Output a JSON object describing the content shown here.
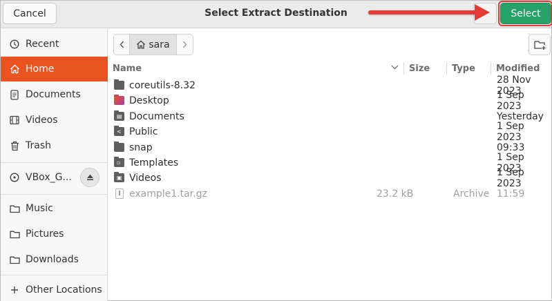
{
  "header": {
    "title": "Select Extract Destination",
    "cancel_label": "Cancel",
    "select_label": "Select"
  },
  "sidebar": {
    "items": [
      {
        "label": "Recent",
        "icon": "clock-icon"
      },
      {
        "label": "Home",
        "icon": "home-icon",
        "active": true
      },
      {
        "label": "Documents",
        "icon": "document-icon"
      },
      {
        "label": "Videos",
        "icon": "film-icon"
      },
      {
        "label": "Trash",
        "icon": "trash-icon"
      },
      {
        "label": "VBox_G...",
        "icon": "disc-icon",
        "eject_icon": "eject-icon"
      },
      {
        "label": "Music",
        "icon": "folder-icon"
      },
      {
        "label": "Pictures",
        "icon": "folder-icon"
      },
      {
        "label": "Downloads",
        "icon": "folder-icon"
      },
      {
        "label": "Other Locations",
        "icon": "plus-icon"
      }
    ]
  },
  "pathbar": {
    "crumb": "sara"
  },
  "columns": {
    "name": "Name",
    "size": "Size",
    "type": "Type",
    "modified": "Modified"
  },
  "files": [
    {
      "name": "coreutils-8.32",
      "size": "",
      "type": "",
      "modified": "28 Nov 2023",
      "kind": "folder"
    },
    {
      "name": "Desktop",
      "size": "",
      "type": "",
      "modified": "1 Sep 2023",
      "kind": "desktop-folder"
    },
    {
      "name": "Documents",
      "size": "",
      "type": "",
      "modified": "Yesterday",
      "kind": "documents-folder"
    },
    {
      "name": "Public",
      "size": "",
      "type": "",
      "modified": "1 Sep 2023",
      "kind": "public-folder"
    },
    {
      "name": "snap",
      "size": "",
      "type": "",
      "modified": "09:33",
      "kind": "folder"
    },
    {
      "name": "Templates",
      "size": "",
      "type": "",
      "modified": "1 Sep 2023",
      "kind": "templates-folder"
    },
    {
      "name": "Videos",
      "size": "",
      "type": "",
      "modified": "1 Sep 2023",
      "kind": "videos-folder"
    },
    {
      "name": "example1.tar.gz",
      "size": "23.2 kB",
      "type": "Archive",
      "modified": "11:59",
      "kind": "archive"
    }
  ],
  "colors": {
    "accent": "#e95420",
    "select_button": "#26a269",
    "annotation": "#e53a35"
  }
}
